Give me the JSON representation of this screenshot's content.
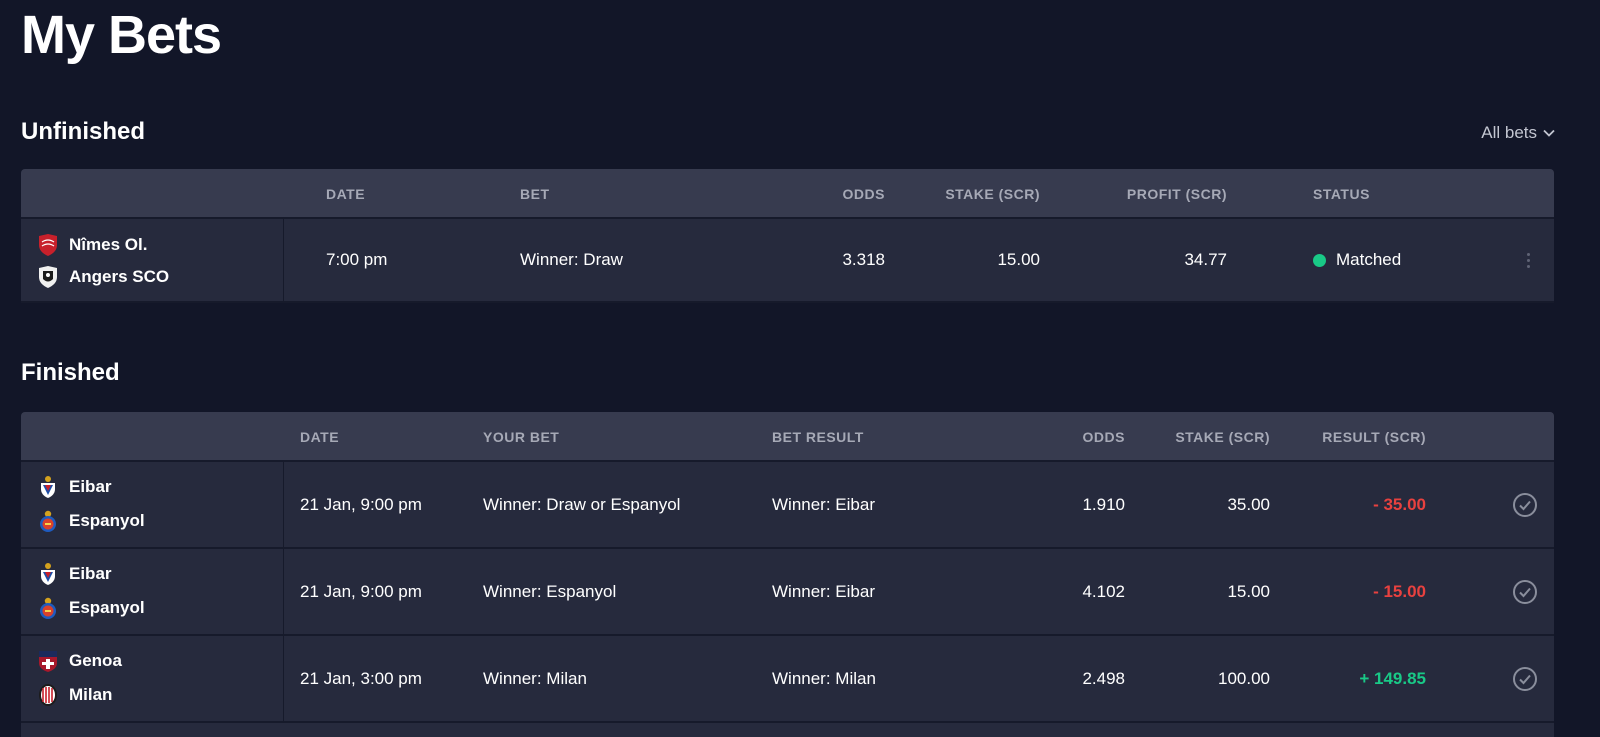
{
  "page": {
    "title": "My Bets"
  },
  "unfinished": {
    "title": "Unfinished",
    "filter_label": "All bets",
    "headers": {
      "date": "DATE",
      "bet": "BET",
      "odds": "ODDS",
      "stake": "STAKE (SCR)",
      "profit": "PROFIT (SCR)",
      "status": "STATUS"
    },
    "rows": [
      {
        "home": "Nîmes Ol.",
        "away": "Angers SCO",
        "home_crest": "nimes-crest-icon",
        "away_crest": "angers-crest-icon",
        "date": "7:00 pm",
        "bet": "Winner: Draw",
        "odds": "3.318",
        "stake": "15.00",
        "profit": "34.77",
        "status": "Matched"
      }
    ]
  },
  "finished": {
    "title": "Finished",
    "headers": {
      "date": "DATE",
      "your_bet": "YOUR BET",
      "bet_result": "BET RESULT",
      "odds": "ODDS",
      "stake": "STAKE (SCR)",
      "result": "RESULT (SCR)"
    },
    "rows": [
      {
        "home": "Eibar",
        "away": "Espanyol",
        "home_crest": "eibar-crest-icon",
        "away_crest": "espanyol-crest-icon",
        "date": "21 Jan, 9:00 pm",
        "your_bet": "Winner: Draw or Espanyol",
        "bet_result": "Winner: Eibar",
        "odds": "1.910",
        "stake": "35.00",
        "result": "- 35.00",
        "outcome": "loss"
      },
      {
        "home": "Eibar",
        "away": "Espanyol",
        "home_crest": "eibar-crest-icon",
        "away_crest": "espanyol-crest-icon",
        "date": "21 Jan, 9:00 pm",
        "your_bet": "Winner: Espanyol",
        "bet_result": "Winner: Eibar",
        "odds": "4.102",
        "stake": "15.00",
        "result": "- 15.00",
        "outcome": "loss"
      },
      {
        "home": "Genoa",
        "away": "Milan",
        "home_crest": "genoa-crest-icon",
        "away_crest": "milan-crest-icon",
        "date": "21 Jan, 3:00 pm",
        "your_bet": "Winner: Milan",
        "bet_result": "Winner: Milan",
        "odds": "2.498",
        "stake": "100.00",
        "result": "+ 149.85",
        "outcome": "win"
      }
    ]
  },
  "colors": {
    "background": "#121628",
    "row": "#262a3d",
    "header": "#373b4f",
    "win": "#19c987",
    "loss": "#e8413f"
  }
}
